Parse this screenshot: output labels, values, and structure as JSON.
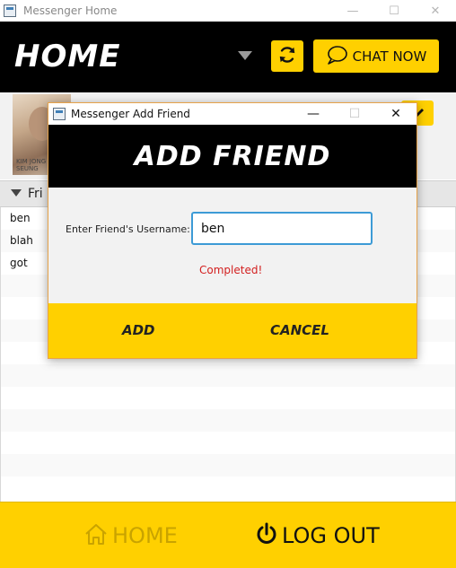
{
  "main_window": {
    "title": "Messenger Home",
    "controls": {
      "minimize": "—",
      "maximize": "☐",
      "close": "✕"
    }
  },
  "header": {
    "title": "HOME",
    "chat_button_label": "CHAT NOW"
  },
  "profile": {
    "avatar_caption_line1": "KIM JONG",
    "avatar_caption_line2": "SEUNG"
  },
  "friends": {
    "header_label": "Fri",
    "items": [
      {
        "name": "ben"
      },
      {
        "name": "blah"
      },
      {
        "name": "got"
      }
    ]
  },
  "footer": {
    "home_label": "HOME",
    "logout_label": "LOG OUT"
  },
  "dialog": {
    "title": "Messenger Add Friend",
    "controls": {
      "minimize": "—",
      "maximize": "☐",
      "close": "✕"
    },
    "banner_title": "ADD FRIEND",
    "field_label": "Enter Friend's Username:",
    "field_value": "ben",
    "status_text": "Completed!",
    "add_label": "ADD",
    "cancel_label": "CANCEL"
  },
  "colors": {
    "accent": "#ffd000",
    "header_bg": "#000000",
    "status": "#d31f1f",
    "input_focus": "#3d9bd6"
  },
  "icons": {
    "refresh": "refresh-icon",
    "chat": "speech-bubble-icon",
    "edit": "pencil-icon",
    "home": "house-icon",
    "logout": "power-icon"
  }
}
